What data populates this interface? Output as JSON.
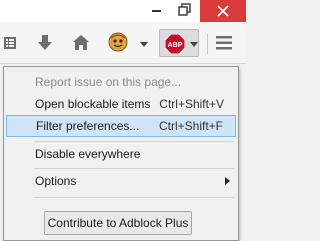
{
  "menu": {
    "report_issue": "Report issue on this page...",
    "open_blockable": "Open blockable items",
    "open_blockable_shortcut": "Ctrl+Shift+V",
    "filter_prefs": "Filter preferences...",
    "filter_prefs_shortcut": "Ctrl+Shift+F",
    "disable_everywhere": "Disable everywhere",
    "options": "Options",
    "contribute": "Contribute to Adblock Plus"
  },
  "toolbar": {
    "abp_badge": "ABP",
    "icons": [
      "reading-list-icon",
      "download-icon",
      "home-icon",
      "avatar-icon",
      "abp-icon",
      "hamburger-menu-icon"
    ]
  },
  "colors": {
    "highlight": "#cfe4f7",
    "highlight_border": "#7db8e8",
    "close_button": "#d93a3a",
    "abp_red": "#c70d2c"
  }
}
